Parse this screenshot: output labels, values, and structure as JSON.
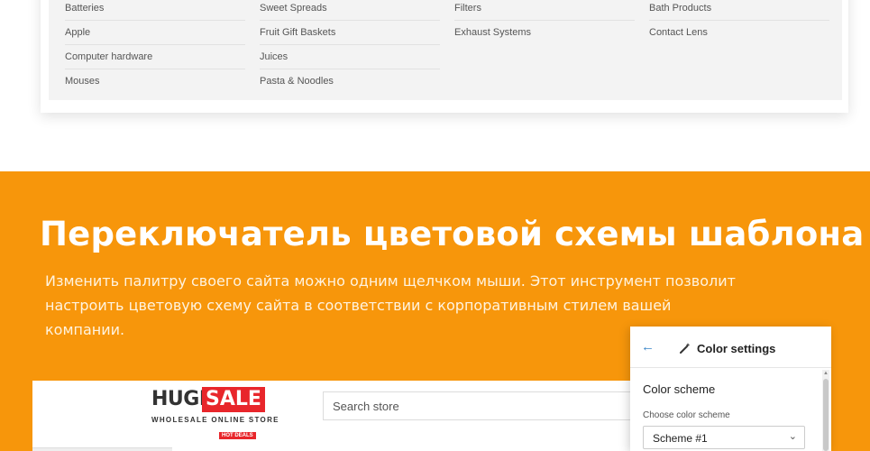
{
  "category_menu": {
    "columns": [
      [
        "Batteries",
        "Apple",
        "Computer hardware",
        "Mouses"
      ],
      [
        "Sweet Spreads",
        "Fruit Gift Baskets",
        "Juices",
        "Pasta & Noodles"
      ],
      [
        "Filters",
        "Exhaust Systems"
      ],
      [
        "Bath Products",
        "Contact Lens"
      ]
    ]
  },
  "promo": {
    "title": "Переключатель цветовой схемы шаблона",
    "description": "Изменить палитру своего сайта можно одним щелчком мыши. Этот инструмент позволит настроить цветовую схему сайта в соответствии с корпоративным стилем вашей компании.",
    "background_color": "#f7960b"
  },
  "store": {
    "logo_huge": "HUGE",
    "logo_sale": "SALE",
    "logo_subtitle": "WHOLESALE ONLINE STORE",
    "search_placeholder": "Search store",
    "hot_badge": "HOT DEALS",
    "brand_red": "#e8262b"
  },
  "color_settings": {
    "title": "Color settings",
    "section_title": "Color scheme",
    "field_label": "Choose color scheme",
    "selected_scheme": "Scheme #1",
    "back_icon": "arrow-left-icon",
    "wand_icon": "magic-wand-icon",
    "accent": "#3a86c8"
  }
}
